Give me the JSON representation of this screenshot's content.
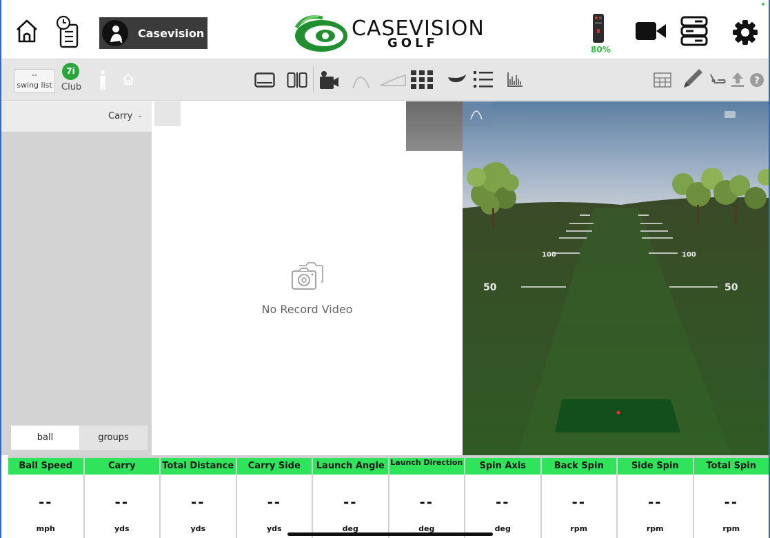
{
  "header": {
    "user_name": "Casevision",
    "logo_text": "CASEVISION",
    "logo_sub": "GOLF",
    "battery_percent": "80%",
    "icons": [
      "home-icon",
      "history-icon",
      "battery-icon",
      "video-camera-icon",
      "device-list-icon",
      "gear-icon"
    ]
  },
  "toolbar": {
    "swing_list_value": "--",
    "swing_list_label": "swing list",
    "club_value": "7i",
    "club_label": "Club",
    "icons": [
      "golfer-icon",
      "range-home-icon",
      "single-view-icon",
      "split-view-icon",
      "camera-view-icon",
      "trajectory-side-icon",
      "trajectory-top-icon",
      "grid-view-icon",
      "club-head-icon",
      "list-view-icon",
      "chart-icon",
      "table-icon",
      "pen-icon",
      "putter-icon",
      "upload-icon",
      "help-icon"
    ]
  },
  "left_panel": {
    "sort_by": "Carry",
    "tabs": [
      {
        "label": "ball",
        "active": true
      },
      {
        "label": "groups",
        "active": false
      }
    ]
  },
  "video_panel": {
    "empty_text": "No Record Video"
  },
  "range": {
    "markers": [
      "50",
      "50",
      "100",
      "100"
    ]
  },
  "stats": [
    {
      "label": "Ball Speed",
      "value": "--",
      "unit": "mph"
    },
    {
      "label": "Carry",
      "value": "--",
      "unit": "yds"
    },
    {
      "label": "Total Distance",
      "value": "--",
      "unit": "yds"
    },
    {
      "label": "Carry Side",
      "value": "--",
      "unit": "yds"
    },
    {
      "label": "Launch Angle",
      "value": "--",
      "unit": "deg"
    },
    {
      "label": "Launch Direction",
      "value": "--",
      "unit": "deg"
    },
    {
      "label": "Spin Axis",
      "value": "--",
      "unit": "deg"
    },
    {
      "label": "Back Spin",
      "value": "--",
      "unit": "rpm"
    },
    {
      "label": "Side Spin",
      "value": "--",
      "unit": "rpm"
    },
    {
      "label": "Total Spin",
      "value": "--",
      "unit": "rpm"
    }
  ],
  "colors": {
    "accent_green": "#2fe35b",
    "club_badge": "#2aa63f",
    "battery_text": "#2fbf3f"
  }
}
